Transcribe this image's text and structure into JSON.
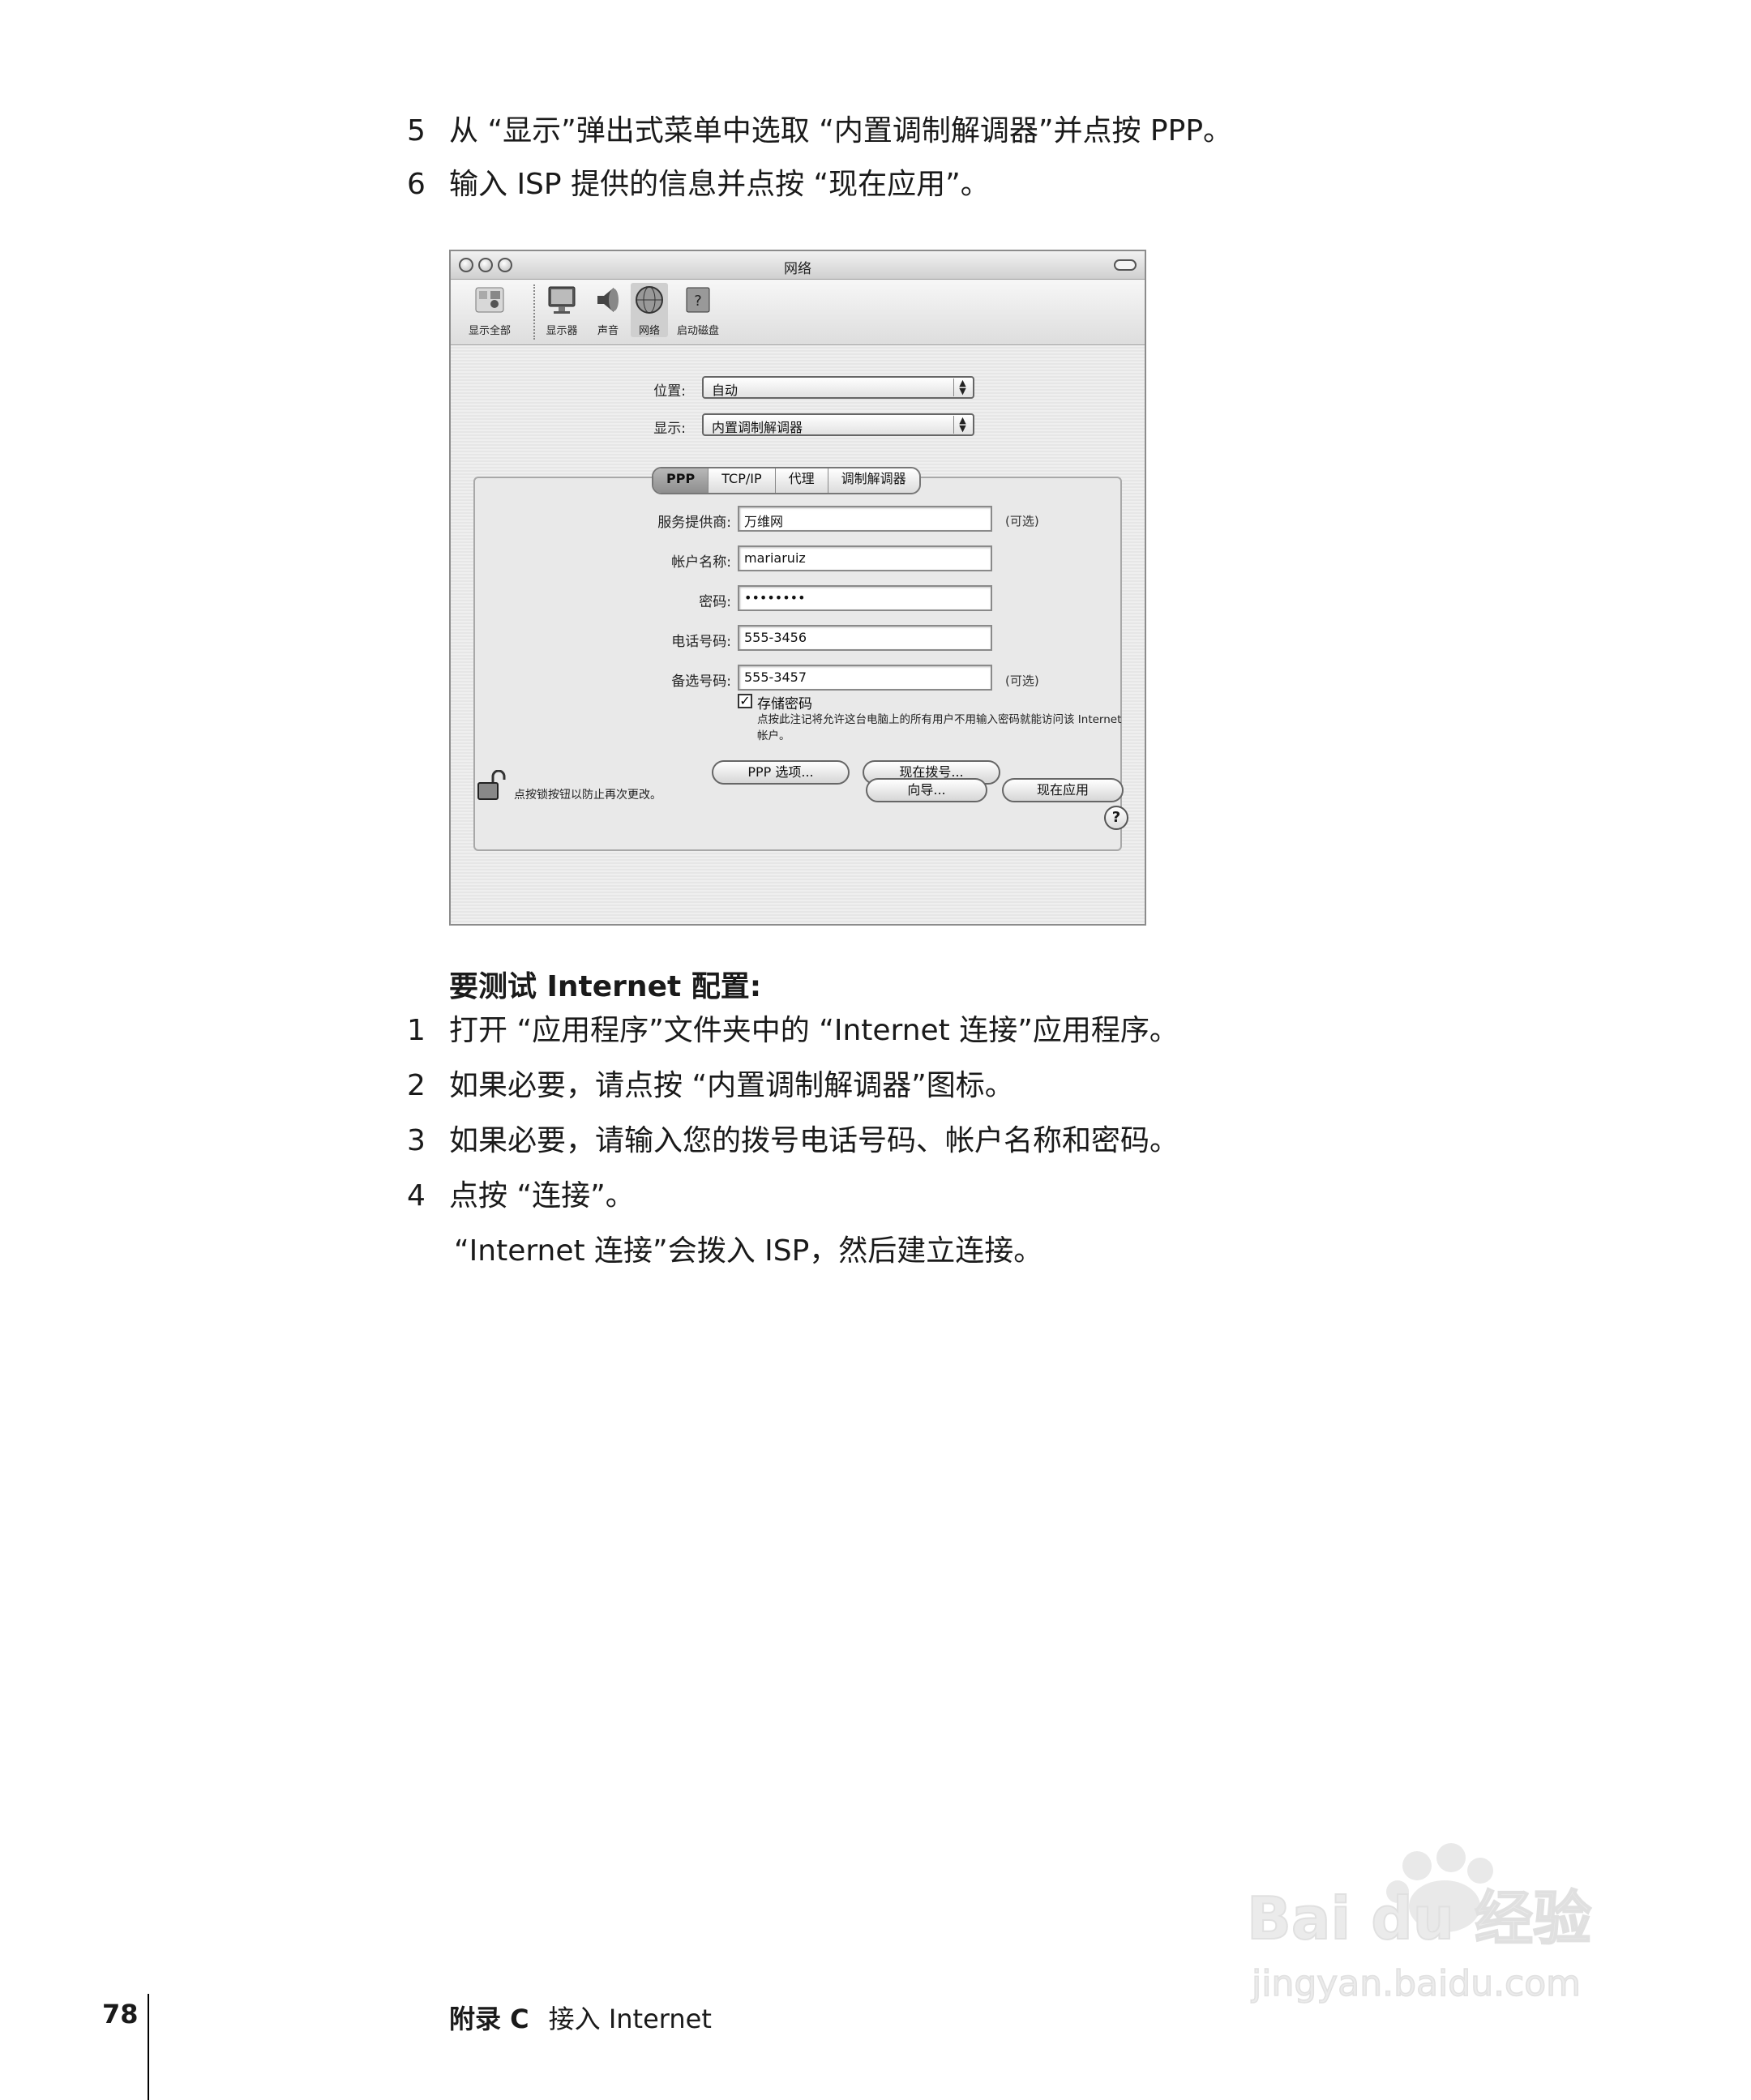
{
  "steps_top": [
    {
      "num": "5",
      "text": "从 “显示”弹出式菜单中选取 “内置调制解调器”并点按 PPP。"
    },
    {
      "num": "6",
      "text": "输入 ISP 提供的信息并点按 “现在应用”。"
    }
  ],
  "window": {
    "title": "网络",
    "toolbar": [
      "显示全部",
      "显示器",
      "声音",
      "网络",
      "启动磁盘"
    ],
    "location_label": "位置:",
    "location_value": "自动",
    "show_label": "显示:",
    "show_value": "内置调制解调器",
    "tabs": [
      "PPP",
      "TCP/IP",
      "代理",
      "调制解调器"
    ],
    "fields": [
      {
        "label": "服务提供商:",
        "value": "万维网",
        "optional": "(可选)"
      },
      {
        "label": "帐户名称:",
        "value": "mariaruiz",
        "optional": ""
      },
      {
        "label": "密码:",
        "value": "••••••••",
        "optional": ""
      },
      {
        "label": "电话号码:",
        "value": "555-3456",
        "optional": ""
      },
      {
        "label": "备选号码:",
        "value": "555-3457",
        "optional": "(可选)"
      }
    ],
    "save_password_label": "存储密码",
    "save_password_note": "点按此注记将允许这台电脑上的所有用户不用输入密码就能访问该 Internet 帐户。",
    "ppp_options_button": "PPP 选项...",
    "dial_now_button": "现在拨号...",
    "help_glyph": "?",
    "lock_text": "点按锁按钮以防止再次更改。",
    "assist_button": "向导...",
    "apply_button": "现在应用"
  },
  "section_heading": "要测试 Internet 配置:",
  "steps_bottom": [
    {
      "num": "1",
      "text": "打开 “应用程序”文件夹中的 “Internet 连接”应用程序。"
    },
    {
      "num": "2",
      "text": "如果必要，请点按 “内置调制解调器”图标。"
    },
    {
      "num": "3",
      "text": "如果必要，请输入您的拨号电话号码、帐户名称和密码。"
    },
    {
      "num": "4",
      "text": "点按 “连接”。"
    }
  ],
  "result_text": "“Internet 连接”会拨入 ISP，然后建立连接。",
  "footer": {
    "page_number": "78",
    "appendix": "附录 C",
    "chapter": "接入 Internet"
  },
  "watermark": {
    "brand": "Bai du 经验",
    "url": "jingyan.baidu.com"
  }
}
